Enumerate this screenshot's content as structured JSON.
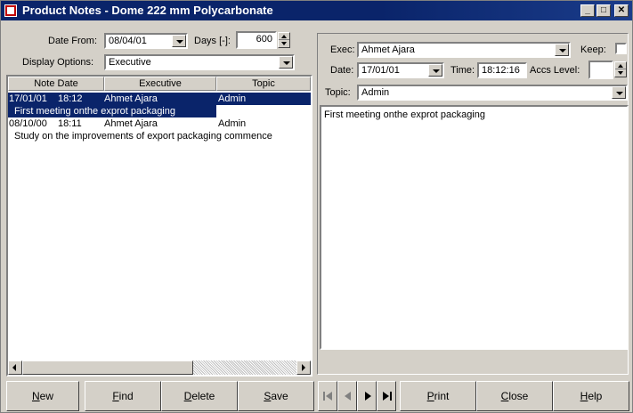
{
  "window": {
    "title": "Product Notes  - Dome 222 mm Polycarbonate",
    "minimize_glyph": "_",
    "maximize_glyph": "□",
    "close_glyph": "✕",
    "app_icon": "notes-app-icon"
  },
  "filters": {
    "date_from_label": "Date From:",
    "date_from_value": "08/04/01",
    "days_label": "Days [-]:",
    "days_value": "600",
    "display_options_label": "Display Options:",
    "display_options_value": "Executive"
  },
  "list": {
    "columns": [
      "Note Date",
      "Executive",
      "Topic"
    ],
    "notes": [
      {
        "date": "17/01/01",
        "time": "18:12",
        "executive": "Ahmet Ajara",
        "topic": "Admin",
        "text": "First meeting onthe exprot packaging",
        "selected": true
      },
      {
        "date": "08/10/00",
        "time": "18:11",
        "executive": "Ahmet Ajara",
        "topic": "Admin",
        "text": "Study on the improvements of export packaging commence",
        "selected": false
      }
    ]
  },
  "detail": {
    "exec_label": "Exec:",
    "exec_value": "Ahmet Ajara",
    "keep_label": "Keep:",
    "date_label": "Date:",
    "date_value": "17/01/01",
    "time_label": "Time:",
    "time_value": "18:12:16",
    "accs_level_label": "Accs Level:",
    "accs_level_value": "",
    "topic_label": "Topic:",
    "topic_value": "Admin",
    "note_text": "First meeting onthe exprot packaging"
  },
  "buttons": {
    "new": {
      "acc": "N",
      "rest": "ew"
    },
    "find": {
      "acc": "F",
      "rest": "ind"
    },
    "delete": {
      "acc": "D",
      "rest": "elete"
    },
    "save": {
      "acc": "S",
      "rest": "ave"
    },
    "print": {
      "acc": "P",
      "rest": "rint"
    },
    "close": {
      "acc": "C",
      "rest": "lose"
    },
    "help": {
      "acc": "H",
      "rest": "elp"
    }
  },
  "colors": {
    "selection": "#0a246a",
    "face": "#d4d0c8",
    "title_bar": "#0a246a"
  }
}
